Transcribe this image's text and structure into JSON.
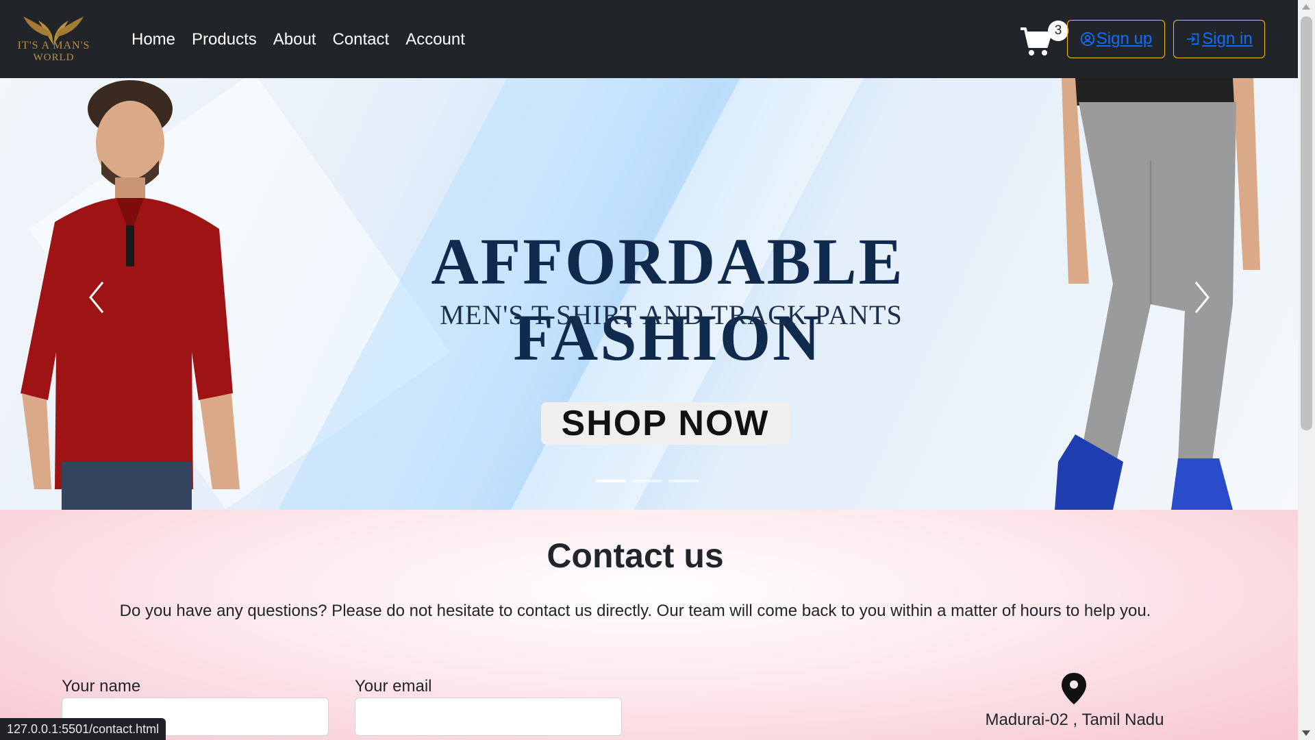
{
  "brand": {
    "logo_line1": "IT'S A MAN'S",
    "logo_line2": "WORLD",
    "accent": "#b8903f"
  },
  "nav": {
    "links": [
      "Home",
      "Products",
      "About",
      "Contact",
      "Account"
    ],
    "cart_count": "3",
    "signup_label": "Sign up",
    "signin_label": "Sign in",
    "icons": {
      "cart": "cart-icon",
      "signup": "user-circle-icon",
      "signin": "sign-in-icon"
    },
    "colors": {
      "bg": "#212529",
      "button_border": "#ffc107",
      "button_text": "#0d6efd"
    }
  },
  "carousel": {
    "headline": "AFFORDABLE FASHION",
    "subline": "MEN'S T-SHIRT AND TRACK PANTS",
    "cta": "SHOP NOW",
    "slides": 3,
    "active_slide": 1
  },
  "contact": {
    "title": "Contact us",
    "description": "Do you have any questions? Please do not hesitate to contact us directly. Our team will come back to you within a matter of hours to help you.",
    "name_label": "Your name",
    "email_label": "Your email",
    "name_value": "",
    "email_value": "",
    "address": "Madurai-02 , Tamil Nadu"
  },
  "status_url": "127.0.0.1:5501/contact.html"
}
